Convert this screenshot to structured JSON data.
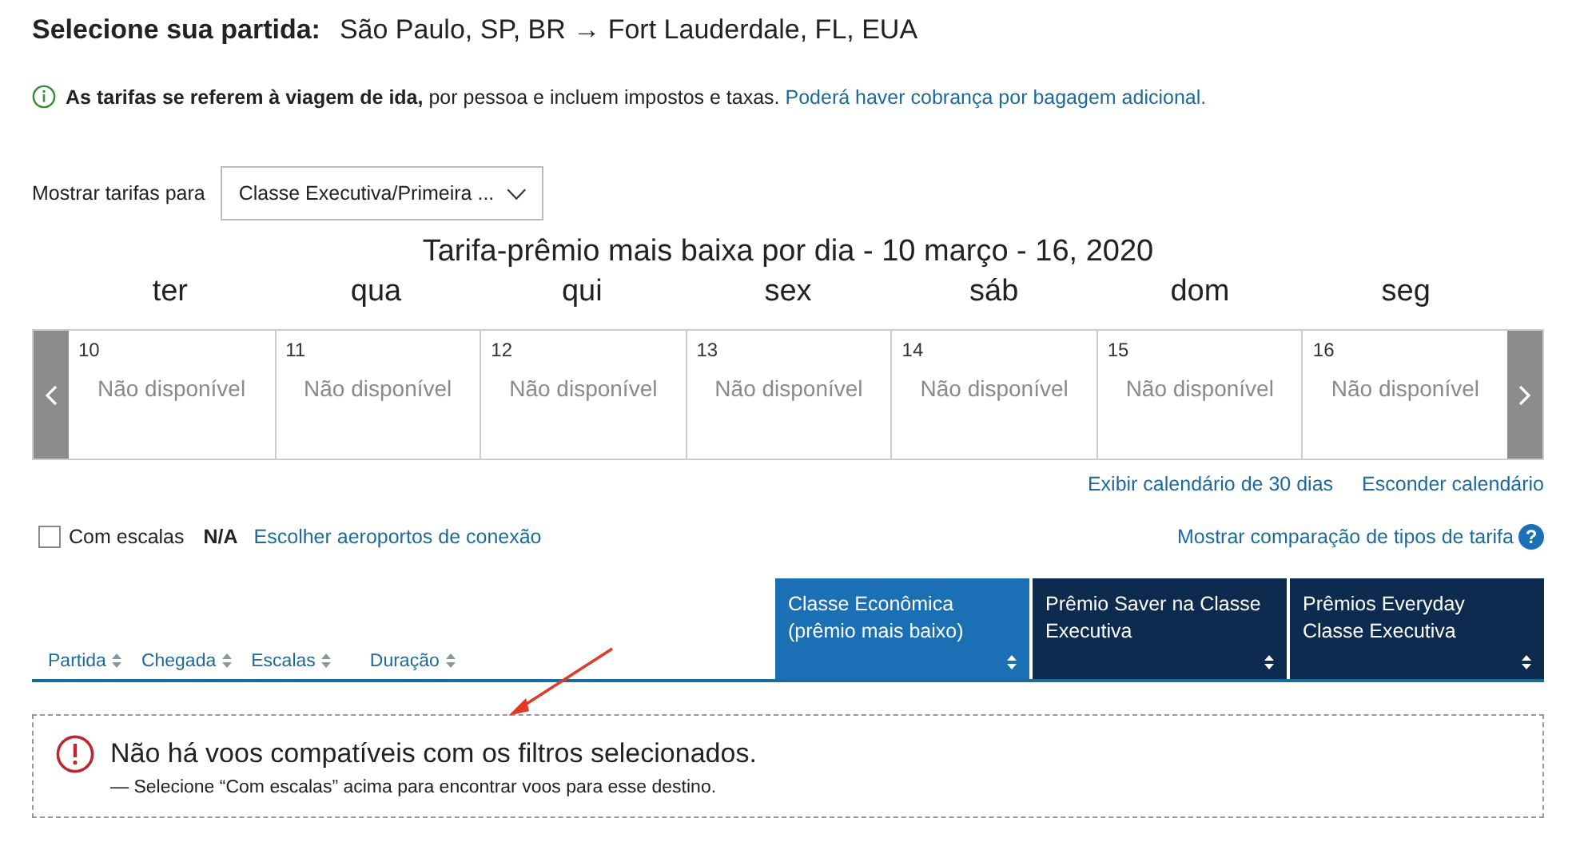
{
  "header": {
    "label": "Selecione sua partida:",
    "route": "São Paulo, SP, BR → Fort Lauderdale, FL, EUA"
  },
  "notice": {
    "text": "**As tarifas se referem à viagem de ida,** por pessoa e incluem impostos e taxas.",
    "link": "Poderá haver cobrança por bagagem adicional."
  },
  "fare_filter": {
    "label": "Mostrar tarifas para",
    "value": "Classe Executiva/Primeira ..."
  },
  "calendar": {
    "title": "Tarifa-prêmio mais baixa por dia - 10 março - 16, 2020",
    "weekdays": [
      "ter",
      "qua",
      "qui",
      "sex",
      "sáb",
      "dom",
      "seg"
    ],
    "days": [
      {
        "date": "10",
        "fare": "Não disponível"
      },
      {
        "date": "11",
        "fare": "Não disponível"
      },
      {
        "date": "12",
        "fare": "Não disponível"
      },
      {
        "date": "13",
        "fare": "Não disponível"
      },
      {
        "date": "14",
        "fare": "Não disponível"
      },
      {
        "date": "15",
        "fare": "Não disponível"
      },
      {
        "date": "16",
        "fare": "Não disponível"
      }
    ]
  },
  "calendar_links": [
    "Exibir calendário de 30 dias",
    "Esconder calendário"
  ],
  "filters": {
    "stops_label": "Com escalas",
    "checked": false,
    "stops_value": "N/A",
    "airports_link": "Escolher aeroportos de conexão",
    "compare_link": "Mostrar comparação de tipos de tarifa",
    "help_symbol": "?"
  },
  "sort_columns": [
    "Partida",
    "Chegada",
    "Escalas",
    "Duração"
  ],
  "fare_columns": [
    {
      "label": "Classe Econômica (prêmio mais baixo)",
      "selected": true
    },
    {
      "label": "Prêmio Saver na Classe Executiva",
      "selected": false
    },
    {
      "label": "Prêmios Everyday Classe Executiva",
      "selected": false
    }
  ],
  "message": {
    "title": "Não há voos compatíveis com os filtros selecionados.",
    "detail": "— Selecione “Com escalas” acima para encontrar voos para esse destino."
  }
}
